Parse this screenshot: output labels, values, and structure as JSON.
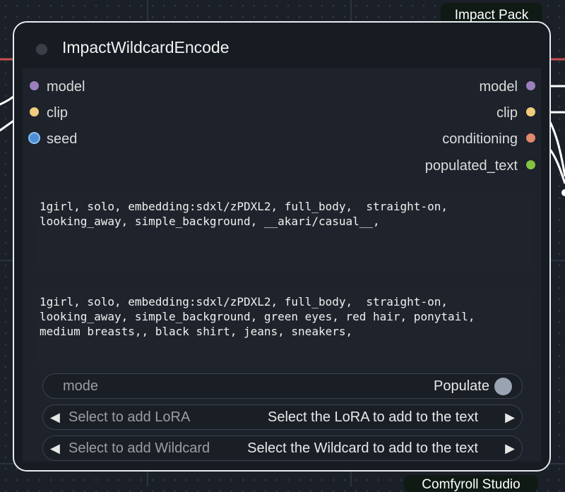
{
  "canvas": {
    "group_title": "Impact Pack",
    "footer_tag": "Comfyroll Studio"
  },
  "node": {
    "title": "ImpactWildcardEncode",
    "inputs": [
      {
        "label": "model",
        "color": "#9a7fbd"
      },
      {
        "label": "clip",
        "color": "#f1cc7c"
      },
      {
        "label": "seed",
        "color": "#4d8ed8"
      }
    ],
    "outputs": [
      {
        "label": "model",
        "color": "#9a7fbd"
      },
      {
        "label": "clip",
        "color": "#f1cc7c"
      },
      {
        "label": "conditioning",
        "color": "#e3876e"
      },
      {
        "label": "populated_text",
        "color": "#82c341"
      }
    ],
    "wildcard_text": "1girl, solo, embedding:sdxl/zPDXL2, full_body,  straight-on,\nlooking_away, simple_background, __akari/casual__,",
    "populated_text": "1girl, solo, embedding:sdxl/zPDXL2, full_body,  straight-on,\nlooking_away, simple_background, green eyes, red hair, ponytail,\nmedium breasts,, black shirt, jeans, sneakers,",
    "mode": {
      "label": "mode",
      "value": "Populate"
    },
    "lora": {
      "label": "Select to add LoRA",
      "value": "Select the LoRA to add to the text"
    },
    "wildcard": {
      "label": "Select to add Wildcard",
      "value": "Select the Wildcard to add to the text"
    }
  }
}
